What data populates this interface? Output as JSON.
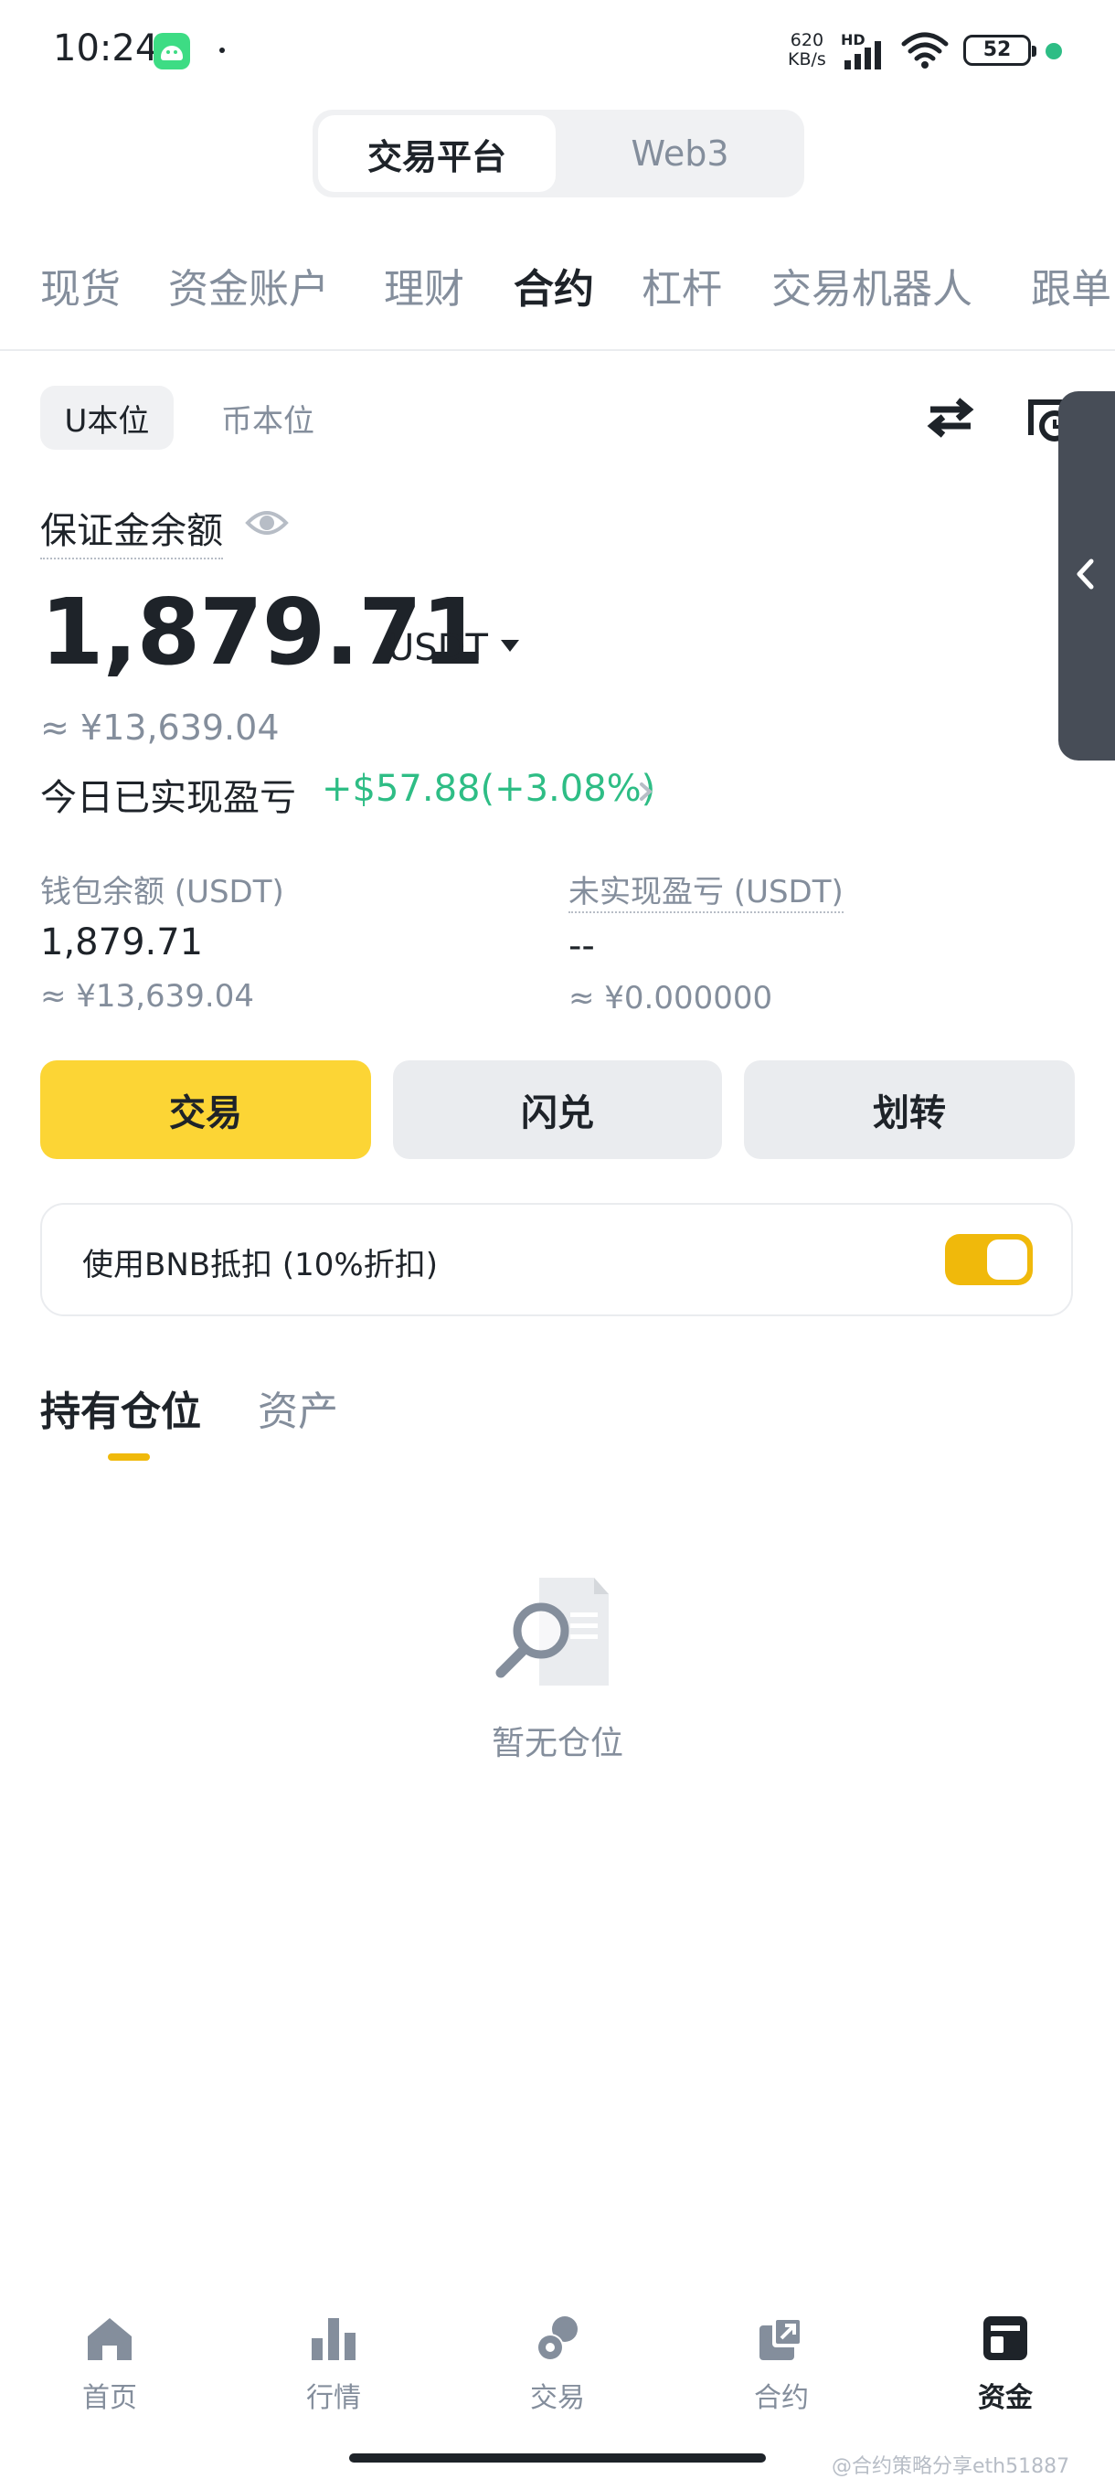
{
  "status_bar": {
    "time": "10:24",
    "net_speed_value": "620",
    "net_speed_unit": "KB/s",
    "hd": "HD",
    "battery": "52"
  },
  "platform_switch": {
    "active": "交易平台",
    "inactive": "Web3"
  },
  "categories": [
    "现货",
    "资金账户",
    "理财",
    "合约",
    "杠杆",
    "交易机器人",
    "跟单"
  ],
  "margin_modes": {
    "active": "U本位",
    "inactive": "币本位"
  },
  "balance": {
    "label": "保证金余额",
    "value": "1,879.71",
    "unit": "USDT",
    "cny": "≈ ¥13,639.04",
    "pnl_label": "今日已实现盈亏",
    "pnl_value": "+$57.88(+3.08%)"
  },
  "wallet": {
    "label": "钱包余额 (USDT)",
    "value": "1,879.71",
    "cny": "≈ ¥13,639.04"
  },
  "unrealized": {
    "label": "未实现盈亏 (USDT)",
    "value": "--",
    "cny": "≈ ¥0.000000"
  },
  "actions": {
    "trade": "交易",
    "convert": "闪兑",
    "transfer": "划转"
  },
  "bnb": {
    "label": "使用BNB抵扣 (10%折扣)",
    "enabled": true
  },
  "position_tabs": {
    "active": "持有仓位",
    "inactive": "资产"
  },
  "empty_state": "暂无仓位",
  "bottom_nav": [
    "首页",
    "行情",
    "交易",
    "合约",
    "资金"
  ],
  "watermark": "@合约策略分享eth51887",
  "colors": {
    "accent": "#fcd535",
    "toggle": "#f0b90b",
    "positive": "#2ebd85",
    "text_primary": "#1e2329",
    "text_secondary": "#848e9c"
  },
  "icons": [
    "android-icon",
    "signal-icon",
    "wifi-icon",
    "battery-icon",
    "swap-icon",
    "history-icon",
    "chevron-left-icon",
    "eye-icon",
    "chevron-down-icon",
    "chevron-right-icon",
    "search-document-icon",
    "home-icon",
    "market-icon",
    "trade-icon",
    "futures-icon",
    "wallet-icon"
  ]
}
